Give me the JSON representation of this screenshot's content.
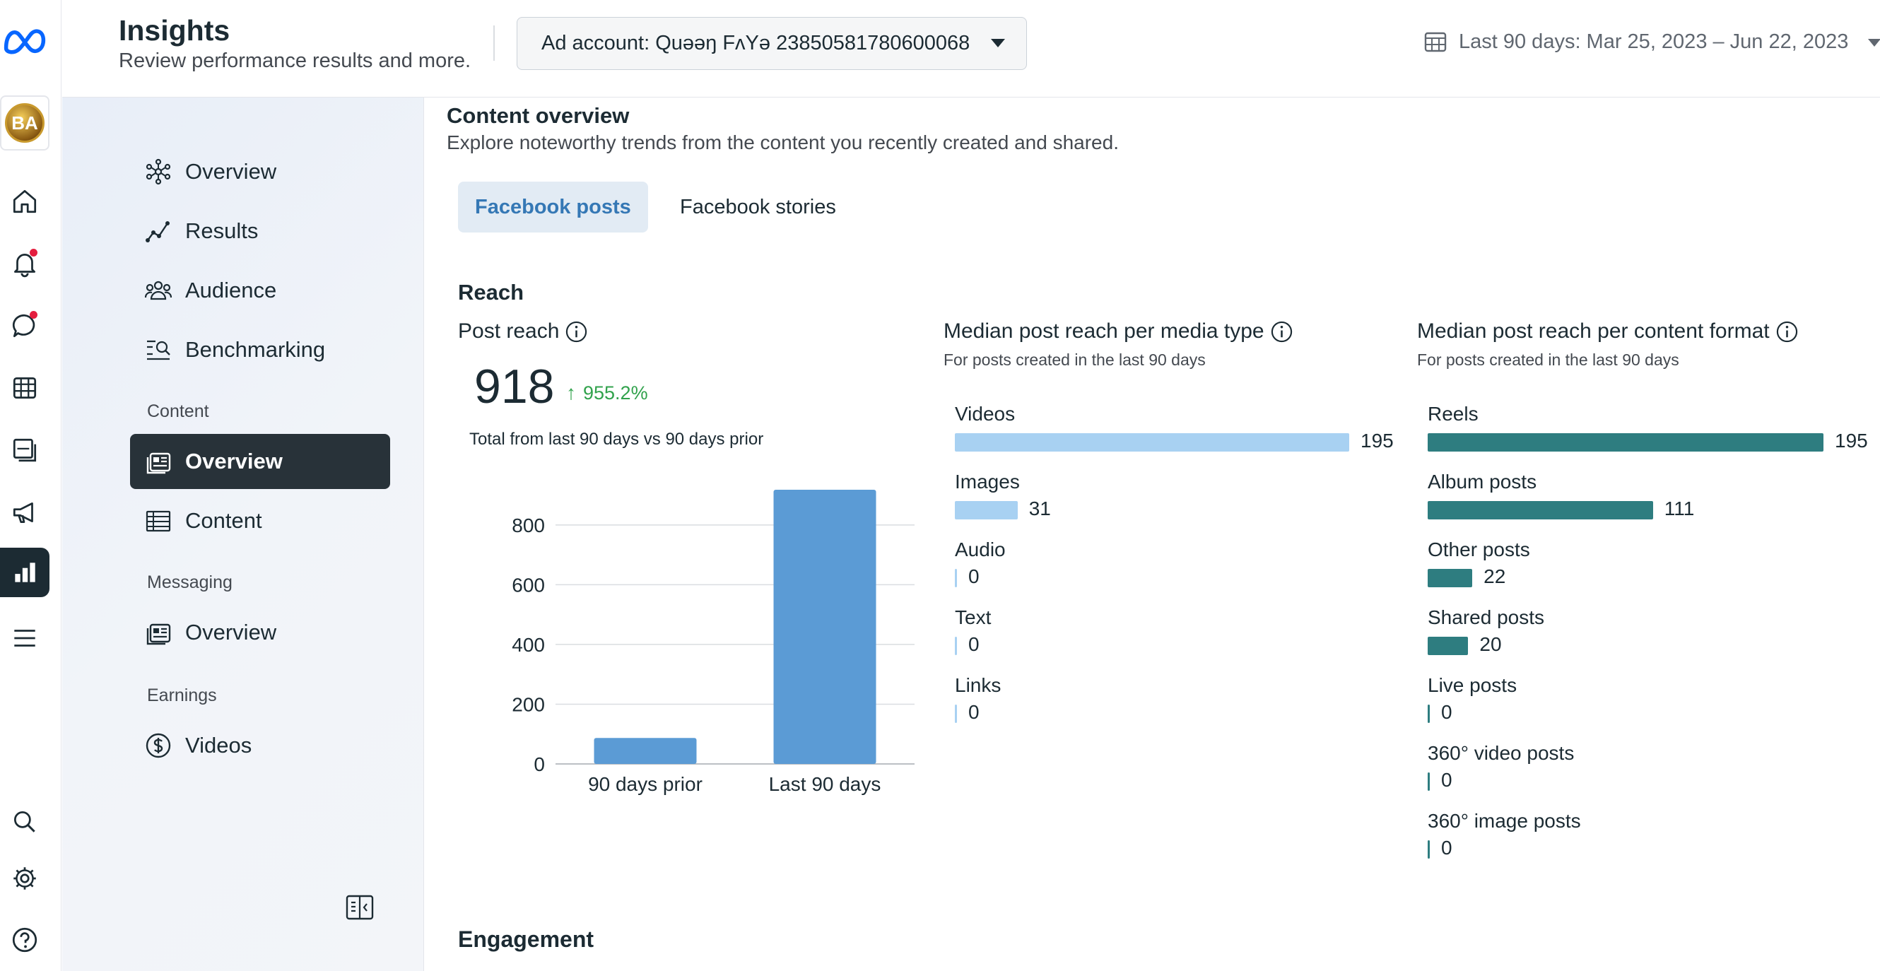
{
  "header": {
    "title": "Insights",
    "subtitle": "Review performance results and more.",
    "ad_account": "Ad account: Quəəŋ FʌYə 23850581780600068",
    "date_range": "Last 90 days: Mar 25, 2023 – Jun 22, 2023"
  },
  "rail": {
    "avatar_initials": "BA",
    "items": [
      "meta-logo",
      "home-icon",
      "bell-icon",
      "chat-icon",
      "table-icon",
      "pages-icon",
      "megaphone-icon",
      "insights-icon",
      "menu-icon",
      "search-icon",
      "gear-icon",
      "help-icon"
    ]
  },
  "sidenav": {
    "items": [
      {
        "label": "Overview",
        "icon": "network-icon"
      },
      {
        "label": "Results",
        "icon": "trend-icon"
      },
      {
        "label": "Audience",
        "icon": "people-icon"
      },
      {
        "label": "Benchmarking",
        "icon": "compare-icon"
      }
    ],
    "content_section": "Content",
    "content_items": [
      {
        "label": "Overview",
        "icon": "content-overview-icon",
        "active": true
      },
      {
        "label": "Content",
        "icon": "table-icon"
      }
    ],
    "messaging_section": "Messaging",
    "messaging_items": [
      {
        "label": "Overview",
        "icon": "messaging-overview-icon"
      }
    ],
    "earnings_section": "Earnings",
    "earnings_items": [
      {
        "label": "Videos",
        "icon": "dollar-icon"
      }
    ]
  },
  "main": {
    "title": "Content overview",
    "description": "Explore noteworthy trends from the content you recently created and shared.",
    "tabs": [
      {
        "label": "Facebook posts",
        "active": true
      },
      {
        "label": "Facebook stories",
        "active": false
      }
    ],
    "reach_title": "Reach",
    "post_reach": {
      "title": "Post reach",
      "value": "918",
      "delta": "955.2%",
      "caption": "Total from last 90 days vs 90 days prior"
    },
    "media_type": {
      "title": "Median post reach per media type",
      "subtitle": "For posts created in the last 90 days",
      "rows": [
        {
          "label": "Videos",
          "value": 195
        },
        {
          "label": "Images",
          "value": 31
        },
        {
          "label": "Audio",
          "value": 0
        },
        {
          "label": "Text",
          "value": 0
        },
        {
          "label": "Links",
          "value": 0
        }
      ],
      "color": "#a8d1f2"
    },
    "content_format": {
      "title": "Median post reach per content format",
      "subtitle": "For posts created in the last 90 days",
      "rows": [
        {
          "label": "Reels",
          "value": 195
        },
        {
          "label": "Album posts",
          "value": 111
        },
        {
          "label": "Other posts",
          "value": 22
        },
        {
          "label": "Shared posts",
          "value": 20
        },
        {
          "label": "Live posts",
          "value": 0
        },
        {
          "label": "360° video posts",
          "value": 0
        },
        {
          "label": "360° image posts",
          "value": 0
        }
      ],
      "color": "#2e7d80"
    },
    "engagement_title": "Engagement"
  },
  "chart_data": {
    "type": "bar",
    "categories": [
      "90 days prior",
      "Last 90 days"
    ],
    "values": [
      87,
      918
    ],
    "ylim": [
      0,
      918
    ],
    "yticks": [
      0,
      200,
      400,
      600,
      800
    ],
    "color": "#5b9bd5",
    "grid": true
  }
}
